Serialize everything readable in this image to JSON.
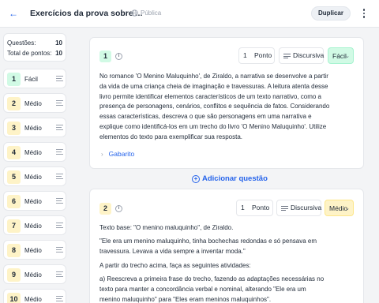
{
  "header": {
    "back_icon": "arrow-left-icon",
    "title": "Exercícios da prova sobre ...",
    "visibility": "Pública",
    "duplicate_label": "Duplicar",
    "menu_icon": "kebab-icon"
  },
  "summary": {
    "questions_label": "Questões:",
    "questions_value": "10",
    "points_label": "Total de pontos:",
    "points_value": "10"
  },
  "colors": {
    "easy": "#d1fae5",
    "medium": "#fef3c7",
    "accent": "#2563eb"
  },
  "sidebar": {
    "items": [
      {
        "number": "1",
        "difficulty": "Fácil"
      },
      {
        "number": "2",
        "difficulty": "Médio"
      },
      {
        "number": "3",
        "difficulty": "Médio"
      },
      {
        "number": "4",
        "difficulty": "Médio"
      },
      {
        "number": "5",
        "difficulty": "Médio"
      },
      {
        "number": "6",
        "difficulty": "Médio"
      },
      {
        "number": "7",
        "difficulty": "Médio"
      },
      {
        "number": "8",
        "difficulty": "Médio"
      },
      {
        "number": "9",
        "difficulty": "Médio"
      },
      {
        "number": "10",
        "difficulty": "Médio"
      }
    ]
  },
  "questions": [
    {
      "number": "1",
      "points": "1",
      "points_unit": "Ponto",
      "type": "Discursiva",
      "difficulty": "Fácil",
      "text": "No romance 'O Menino Maluquinho', de Ziraldo, a narrativa se desenvolve a partir da vida de uma criança cheia de imaginação e travessuras. A leitura atenta desse livro permite identificar elementos característicos de um texto narrativo, como a presença de personagens, cenários, conflitos e sequência de fatos. Considerando essas características, descreva o que são personagens em uma narrativa e explique como identificá-los em um trecho do livro 'O Menino Maluquinho'. Utilize elementos do texto para exemplificar sua resposta.",
      "answer_label": "Gabarito"
    },
    {
      "number": "2",
      "points": "1",
      "points_unit": "Ponto",
      "type": "Discursiva",
      "difficulty": "Médio",
      "paragraphs": [
        "Texto base: \"O menino maluquinho\", de Ziraldo.",
        "\"Ele era um menino maluquinho, tinha bochechas redondas e só pensava em travessura. Levava a vida sempre a inventar moda.\"",
        "A partir do trecho acima, faça as seguintes atividades:",
        "a) Reescreva a primeira frase do trecho, fazendo as adaptações necessárias no texto para manter a concordância verbal e nominal, alterando \"Ele era um menino maluquinho\" para \"Eles eram meninos maluquinhos\"."
      ]
    }
  ],
  "add_question_label": "Adicionar questão"
}
